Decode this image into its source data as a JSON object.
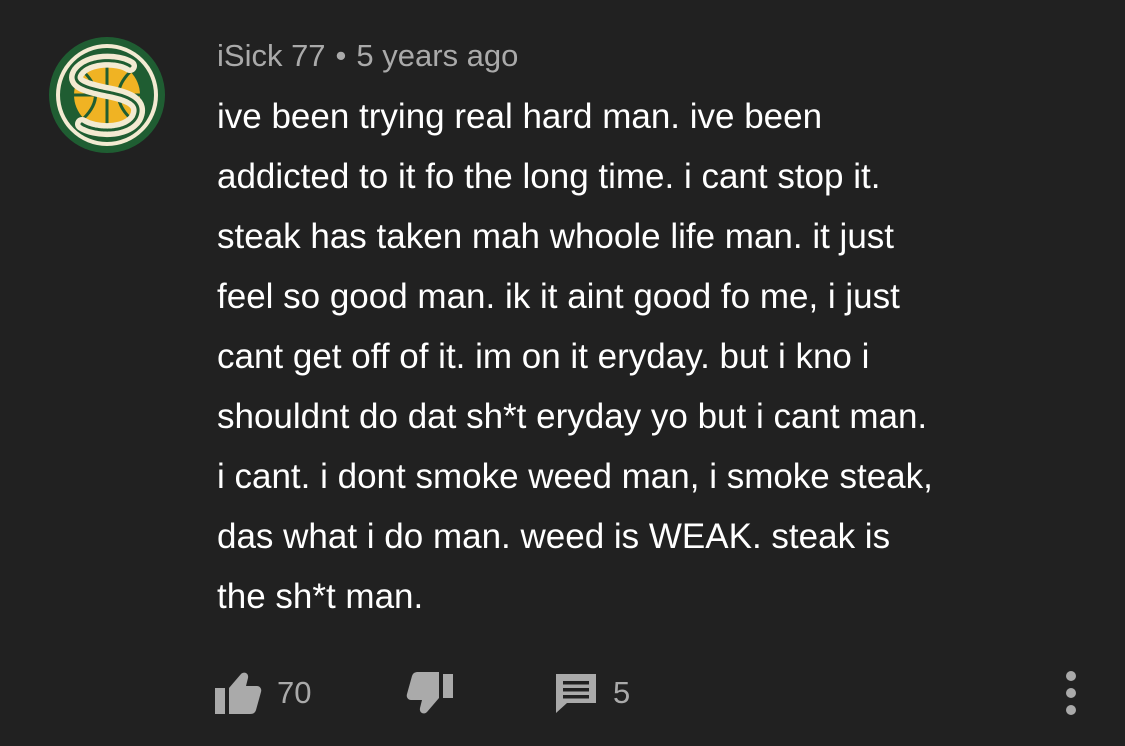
{
  "comment": {
    "author": "iSick 77",
    "separator": "•",
    "timestamp": "5 years ago",
    "text": "ive been trying real hard man. ive been\naddicted to it fo the long time. i cant stop it.\nsteak has taken mah whoole life man. it just\nfeel so good man. ik it aint good fo me, i just\ncant get off of it. im on it eryday. but i kno i\nshouldnt do dat sh*t eryday yo but i cant man.\ni cant. i dont smoke weed man, i smoke steak,\ndas what i do man. weed is WEAK. steak is\nthe sh*t man.",
    "avatar": {
      "icon": "sonics-logo-icon",
      "colors": {
        "green": "#1f5d32",
        "gold": "#f0b323",
        "cream": "#f3ead2"
      }
    }
  },
  "actions": {
    "like_icon": "thumbs-up-icon",
    "like_count": "70",
    "dislike_icon": "thumbs-down-icon",
    "reply_icon": "reply-comment-icon",
    "reply_count": "5",
    "more_icon": "more-vertical-icon"
  },
  "theme": {
    "background": "#212121",
    "text_primary": "#ffffff",
    "text_secondary": "#aaaaaa"
  }
}
